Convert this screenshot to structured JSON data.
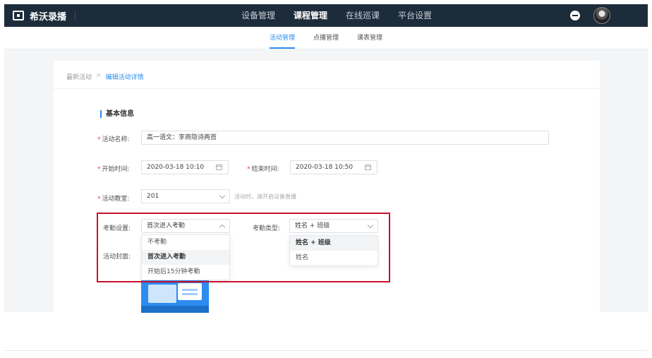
{
  "app": {
    "name": "希沃录播"
  },
  "top_nav": {
    "items": [
      {
        "label": "设备管理",
        "active": false
      },
      {
        "label": "课程管理",
        "active": true
      },
      {
        "label": "在线巡课",
        "active": false
      },
      {
        "label": "平台设置",
        "active": false
      }
    ]
  },
  "sub_nav": {
    "tabs": [
      {
        "label": "活动管理",
        "active": true
      },
      {
        "label": "点播管理",
        "active": false
      },
      {
        "label": "课表管理",
        "active": false
      }
    ]
  },
  "breadcrumb": {
    "parent": "最新活动",
    "separator": ">",
    "current": "编辑活动详情"
  },
  "section": {
    "title": "基本信息"
  },
  "form": {
    "activity_name": {
      "label": "活动名称:",
      "value": "高一语文：李商隐诗两首"
    },
    "start_time": {
      "label": "开始时间:",
      "value": "2020-03-18 10:10"
    },
    "end_time": {
      "label": "结束时间:",
      "value": "2020-03-18 10:50"
    },
    "classroom": {
      "label": "活动教室:",
      "value": "201",
      "hint": "活动时，请开启设备直播"
    },
    "attendance_setting": {
      "label": "考勤设置:",
      "value": "首次进入考勤",
      "options": [
        "不考勤",
        "首次进入考勤",
        "开始后15分钟考勤"
      ]
    },
    "attendance_type": {
      "label": "考勤类型:",
      "value": "姓名 + 班级",
      "options": [
        "姓名 + 班级",
        "姓名"
      ]
    },
    "cover": {
      "label": "活动封面:"
    }
  },
  "colors": {
    "accent": "#2d8cf0",
    "topbar": "#1d2c3a",
    "highlight": "#c8102e",
    "required": "#e4393c"
  }
}
